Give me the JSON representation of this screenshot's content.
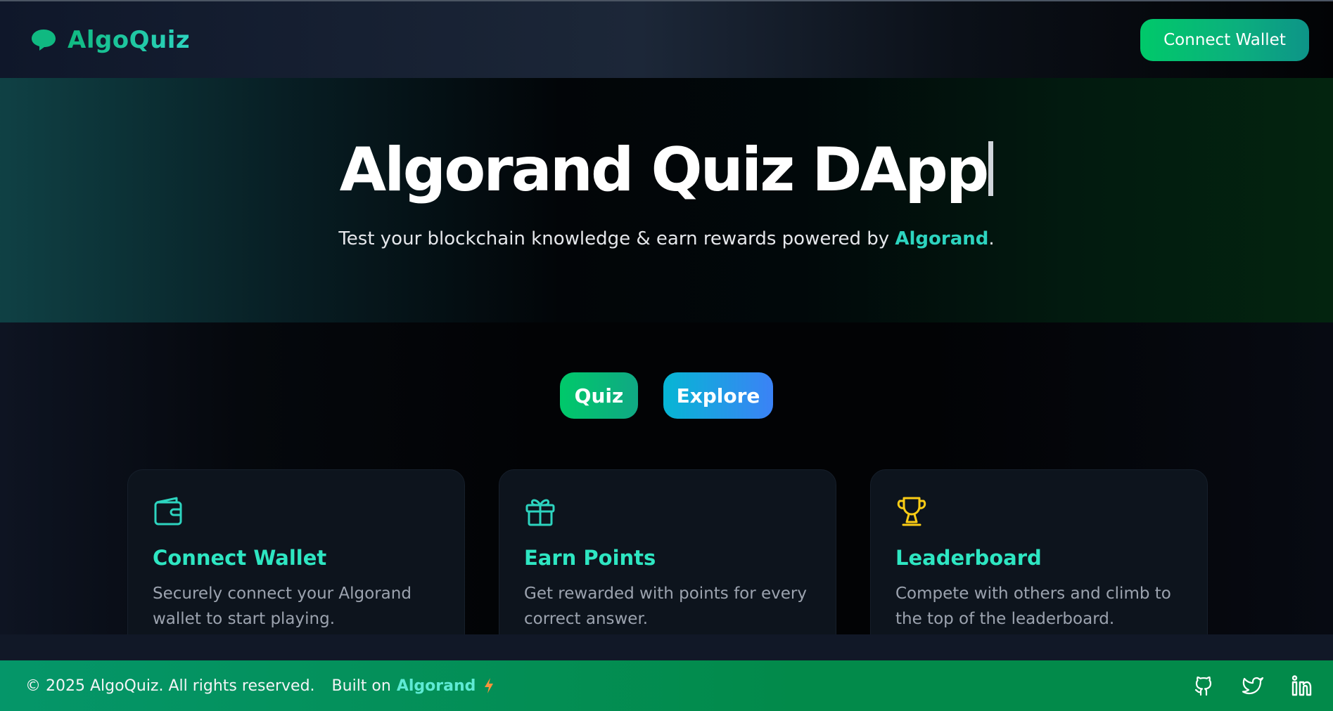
{
  "header": {
    "brand": "AlgoQuiz",
    "brand_icon": "chat-bubble-icon",
    "connect_button": "Connect Wallet"
  },
  "hero": {
    "title": "Algorand Quiz DApp",
    "subtitle_prefix": "Test your blockchain knowledge & earn rewards powered by ",
    "subtitle_accent": "Algorand",
    "subtitle_suffix": "."
  },
  "actions": {
    "quiz": "Quiz",
    "explore": "Explore"
  },
  "features": [
    {
      "icon": "wallet-icon",
      "title": "Connect Wallet",
      "description": "Securely connect your Algorand wallet to start playing."
    },
    {
      "icon": "gift-icon",
      "title": "Earn Points",
      "description": "Get rewarded with points for every correct answer."
    },
    {
      "icon": "trophy-icon",
      "title": "Leaderboard",
      "description": "Compete with others and climb to the top of the leaderboard."
    }
  ],
  "footer": {
    "copyright": "© 2025 AlgoQuiz. All rights reserved.",
    "built_on": "Built on",
    "built_accent": "Algorand",
    "social": [
      "github-icon",
      "twitter-icon",
      "linkedin-icon"
    ]
  },
  "colors": {
    "accent": "#2dd4bf",
    "green": "#00c96a",
    "blue": "#3b82f6",
    "gold": "#facc15"
  }
}
